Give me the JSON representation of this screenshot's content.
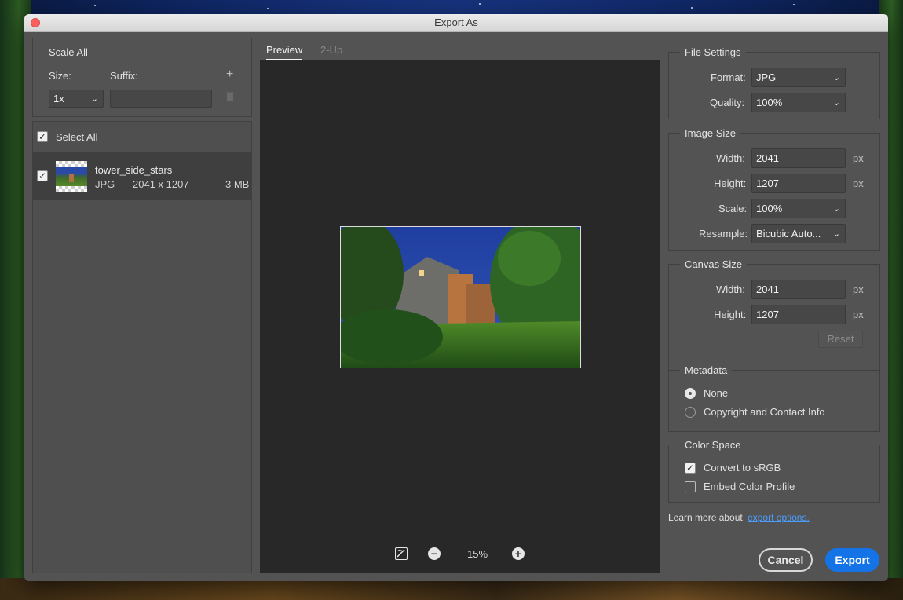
{
  "window": {
    "title": "Export As"
  },
  "left": {
    "scale_all_title": "Scale All",
    "size_label": "Size:",
    "suffix_label": "Suffix:",
    "size_value": "1x",
    "suffix_value": "",
    "add_symbol": "+",
    "select_all_label": "Select All",
    "asset": {
      "name": "tower_side_stars",
      "format": "JPG",
      "dimensions": "2041 x 1207",
      "filesize": "3 MB"
    }
  },
  "preview": {
    "tabs": [
      "Preview",
      "2-Up"
    ],
    "zoom": "15%"
  },
  "file_settings": {
    "title": "File Settings",
    "format_label": "Format:",
    "format_value": "JPG",
    "quality_label": "Quality:",
    "quality_value": "100%"
  },
  "image_size": {
    "title": "Image Size",
    "width_label": "Width:",
    "width_value": "2041",
    "height_label": "Height:",
    "height_value": "1207",
    "scale_label": "Scale:",
    "scale_value": "100%",
    "resample_label": "Resample:",
    "resample_value": "Bicubic Auto...",
    "unit": "px"
  },
  "canvas_size": {
    "title": "Canvas Size",
    "width_label": "Width:",
    "width_value": "2041",
    "height_label": "Height:",
    "height_value": "1207",
    "unit": "px",
    "reset_label": "Reset"
  },
  "metadata": {
    "title": "Metadata",
    "options": [
      "None",
      "Copyright and Contact Info"
    ],
    "selected": "None"
  },
  "color_space": {
    "title": "Color Space",
    "convert_label": "Convert to sRGB",
    "convert_checked": true,
    "embed_label": "Embed Color Profile",
    "embed_checked": false
  },
  "footer": {
    "learn_more": "Learn more about",
    "link_text": "export options.",
    "cancel_label": "Cancel",
    "export_label": "Export"
  },
  "colors": {
    "accent": "#1473e6",
    "panel": "#535353",
    "preview_bg": "#282828"
  }
}
